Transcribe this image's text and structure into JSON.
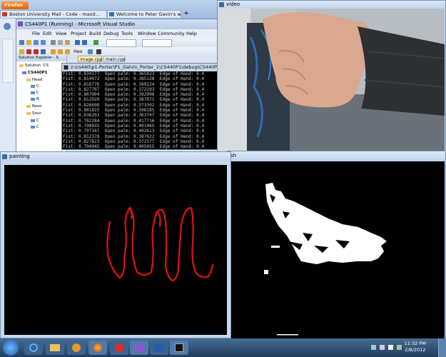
{
  "firefox": {
    "button_label": "Firefox",
    "tabs": [
      {
        "label": "Boston University Mail - Code - maxd...",
        "color": "#c0392b"
      },
      {
        "label": "Welcome to Peter Gavin's web page",
        "color": "#3a6fb0"
      }
    ],
    "new_tab": "+"
  },
  "vs": {
    "title": "CS440P1 (Running) - Microsoft Visual Studio",
    "menu": [
      "File",
      "Edit",
      "View",
      "Project",
      "Build",
      "Debug",
      "Tools",
      "Window",
      "Community",
      "Help"
    ],
    "toolbar_hex": "Hex",
    "solution_header": "Solution Explorer - S",
    "tree": [
      "Solution 'CS",
      "CS440P1",
      "Head",
      "C",
      "C",
      "R",
      "Reso",
      "Sour",
      "C",
      "C"
    ]
  },
  "console": {
    "title": "z:\\cs440\\p1-Porter\\P1_Galvin_Porter_1\\CS440P1\\debug\\CS440P1.exe",
    "tab_label": "image.cpp",
    "tab2_label": "main.cpp",
    "lines": [
      "Fist: 0.834177  Open palm: 0.365823  Edge of Hand: 0.4",
      "Fist: 0.814072  Open palm: 0.385128  Edge of Hand: 0.4",
      "Fist: 0.810776  Open palm: 0.389224  Edge of Hand: 0.4",
      "Fist: 0.827707  Open palm: 0.372293  Edge of Hand: 0.4",
      "Fist: 0.807004  Open palm: 0.392996  Edge of Hand: 0.4",
      "Fist: 0.812929  Open palm: 0.387071  Edge of Hand: 0.4",
      "Fist: 0.826698  Open palm: 0.373302  Edge of Hand: 0.4",
      "Fist: 0.801815  Open palm: 0.398185  Edge of Hand: 0.4",
      "Fist: 0.836293  Open palm: 0.363707  Edge of Hand: 0.4",
      "Fist: 0.782284  Open palm: 0.417716  Edge of Hand: 0.4",
      "Fist: 0.798935  Open palm: 0.401065  Edge of Hand: 0.4",
      "Fist: 0.797187  Open palm: 0.402813  Edge of Hand: 0.4",
      "Fist: 0.812378  Open palm: 0.387622  Edge of Hand: 0.4",
      "Fist: 0.827623  Open palm: 0.372377  Edge of Hand: 0.4",
      "Fist: 0.794945  Open palm: 0.405055  Edge of Hand: 0.4",
      "Fist: 0.781014  Open palm: 0.418986  Edge of Hand: 0.4",
      "Fist: 0.785036  Open palm: 0.414964  Edge of Hand: 0.4",
      "Fist: 0.808249  Open palm: 0.391751  Edge of Hand: 0.4",
      "Fist: 0.798334  Open palm: 0.401666  Edge of Hand: 0.4"
    ]
  },
  "video": {
    "title": "video"
  },
  "threshold": {
    "title": "sh"
  },
  "painting": {
    "title": "painting"
  },
  "taskbar": {
    "time": "11:32 PM",
    "date": "2/8/2012"
  },
  "colors": {
    "paint_stroke": "#e01010",
    "taskbar": "#2b4a6b"
  }
}
